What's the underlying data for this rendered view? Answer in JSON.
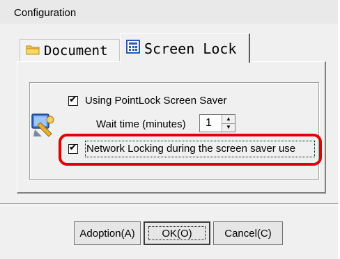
{
  "window": {
    "title": "Configuration"
  },
  "tabs": [
    {
      "label": "Document",
      "icon": "folder-icon",
      "active": false
    },
    {
      "label": "Screen Lock",
      "icon": "calculator-icon",
      "active": true
    }
  ],
  "screen_lock": {
    "app_icon": "pointlock-screensaver-icon",
    "using_screensaver": {
      "label": "Using PointLock Screen Saver",
      "checked": true
    },
    "wait_time": {
      "label": "Wait time (minutes)",
      "value": "1"
    },
    "network_locking": {
      "label": "Network Locking during the screen saver use",
      "checked": true
    }
  },
  "buttons": {
    "adoption": "Adoption(A)",
    "ok": "OK(O)",
    "cancel": "Cancel(C)"
  },
  "colors": {
    "highlight": "#e20000",
    "dialog_bg": "#f0f0f0"
  }
}
